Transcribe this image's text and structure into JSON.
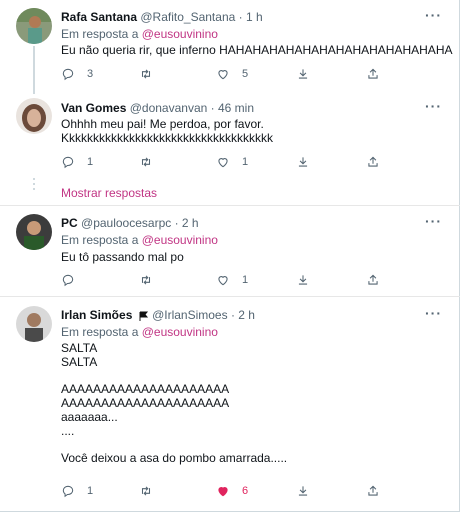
{
  "tweets": [
    {
      "name": "Rafa Santana",
      "handle": "@Rafito_Santana",
      "time": "· 1 h",
      "reply_prefix": "Em resposta a",
      "reply_mention": "@eusouvinino",
      "text": "Eu não queria rir, que inferno HAHAHAHAHAHAHAHAHAHAHAHAHAHA",
      "counts": {
        "reply": "3",
        "retweet": "",
        "like": "5"
      }
    },
    {
      "name": "Van Gomes",
      "handle": "@donavanvan",
      "time": "· 46 min",
      "text": "Ohhhh meu pai! Me perdoa, por favor.\nKkkkkkkkkkkkkkkkkkkkkkkkkkkkkkkkkkk",
      "counts": {
        "reply": "1",
        "retweet": "",
        "like": "1"
      }
    },
    {
      "name": "PC",
      "handle": "@pauloocesarpc",
      "time": "· 2 h",
      "reply_prefix": "Em resposta a",
      "reply_mention": "@eusouvinino",
      "text": "Eu tô passando mal po",
      "counts": {
        "reply": "",
        "retweet": "",
        "like": "1"
      }
    },
    {
      "name": "Irlan Simões",
      "handle": "@IrlanSimoes",
      "time": "· 2 h",
      "reply_prefix": "Em resposta a",
      "reply_mention": "@eusouvinino",
      "text": "SALTA\nSALTA\n\nAAAAAAAAAAAAAAAAAAAAA\nAAAAAAAAAAAAAAAAAAAAA\naaaaaaa...\n....\n\nVocê deixou a asa do pombo amarrada.....",
      "counts": {
        "reply": "1",
        "retweet": "",
        "like": "6"
      }
    }
  ],
  "show_replies": "Mostrar respostas",
  "more_glyph": "···",
  "colors": {
    "accent": "#c13584",
    "like_active": "#e0245e",
    "muted": "#536471"
  },
  "icons": [
    "reply-icon",
    "retweet-icon",
    "like-icon",
    "share-icon",
    "more-icon",
    "flag-icon"
  ]
}
